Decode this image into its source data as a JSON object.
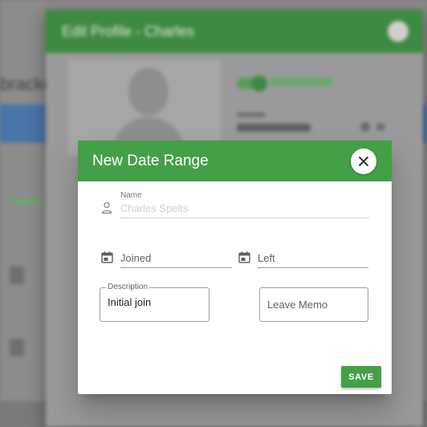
{
  "background": {
    "profile_title": "Edit Profile - Charles",
    "left_text": "bracket",
    "toggle_label": "Profile is enabled",
    "account_label": "Account",
    "account_value": "Charles and Ruth"
  },
  "dialog": {
    "title": "New Date Range",
    "close_icon": "close-icon",
    "name": {
      "label": "Name",
      "value": "Charles Spelts",
      "icon": "person-icon"
    },
    "joined": {
      "placeholder": "Joined",
      "icon": "calendar-icon"
    },
    "left": {
      "placeholder": "Left",
      "icon": "calendar-icon"
    },
    "description": {
      "label": "Description",
      "value": "Initial join"
    },
    "leave_memo": {
      "placeholder": "Leave Memo"
    },
    "save_label": "SAVE"
  },
  "colors": {
    "primary": "#43a047",
    "header_text": "#ffffff"
  }
}
